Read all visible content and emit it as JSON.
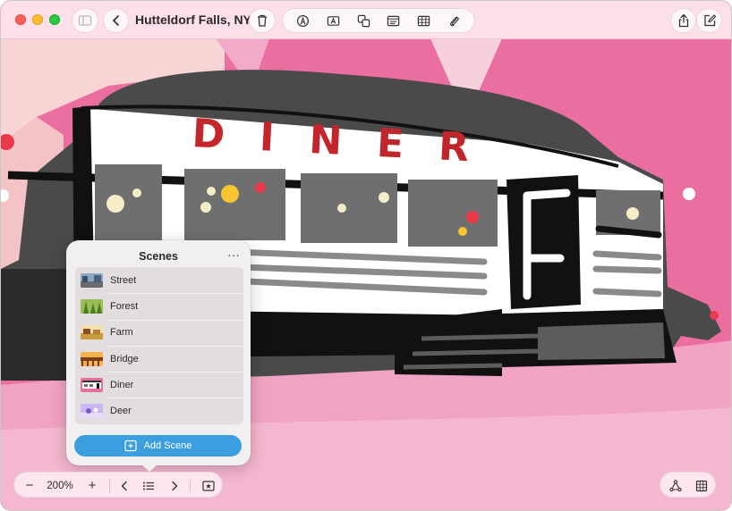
{
  "window": {
    "title": "Hutteldorf Falls, NY"
  },
  "toolbar": {
    "sidebar_icon": "sidebar-icon",
    "back_icon": "chevron-left-icon",
    "delete_icon": "trash-icon",
    "tools": [
      "pen-tip-icon",
      "text-box-icon",
      "shapes-icon",
      "caption-icon",
      "table-icon",
      "paperclip-icon"
    ],
    "share_icon": "share-icon",
    "compose_icon": "compose-icon"
  },
  "canvas": {
    "sign_text": "DINER"
  },
  "scenes_panel": {
    "title": "Scenes",
    "more_label": "···",
    "items": [
      {
        "label": "Street"
      },
      {
        "label": "Forest"
      },
      {
        "label": "Farm"
      },
      {
        "label": "Bridge"
      },
      {
        "label": "Diner"
      },
      {
        "label": "Deer"
      }
    ],
    "add_label": "Add Scene"
  },
  "bottom_bar": {
    "zoom_out_label": "−",
    "zoom_level": "200%",
    "zoom_in_label": "+",
    "prev_icon": "chevron-left-icon",
    "scenes_icon": "list-icon",
    "next_icon": "chevron-right-icon",
    "add_scene_icon": "star-frame-icon",
    "connect_icon": "connector-icon",
    "grid_icon": "grid-icon"
  },
  "colors": {
    "accent": "#3b9fdf",
    "canvas_pink": "#ea6fa0",
    "toolbar_bg": "#fce4ec"
  }
}
